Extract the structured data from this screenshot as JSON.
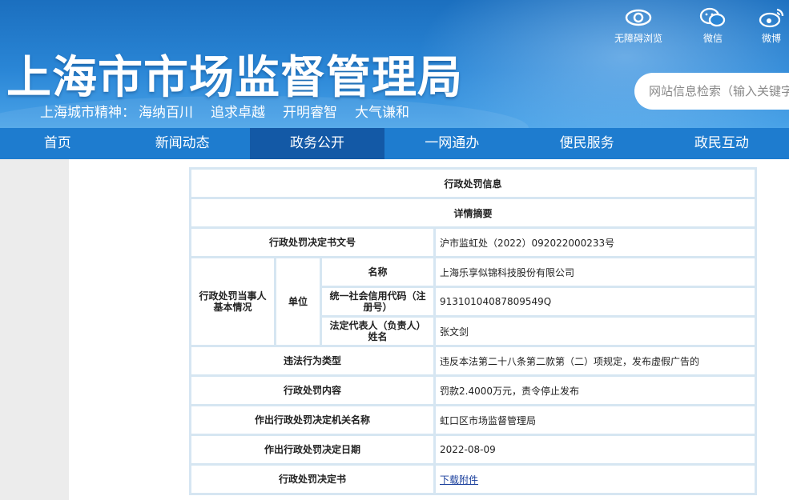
{
  "header": {
    "site_title": "上海市市场监督管理局",
    "city_spirit_lead": "上海城市精神：",
    "city_spirit": [
      "海纳百川",
      "追求卓越",
      "开明睿智",
      "大气谦和"
    ],
    "tools": {
      "accessibility": "无障碍浏览",
      "wechat": "微信",
      "weibo": "微博"
    },
    "search_placeholder": "网站信息检索（输入关键字"
  },
  "nav": [
    "首页",
    "新闻动态",
    "政务公开",
    "一网通办",
    "便民服务",
    "政民互动"
  ],
  "nav_active": "政务公开",
  "penalty": {
    "title": "行政处罚信息",
    "summary": "详情摘要",
    "doc_no_label": "行政处罚决定书文号",
    "doc_no": "沪市监虹处（2022）092022000233号",
    "party_label": "行政处罚当事人基本情况",
    "unit_label": "单位",
    "name_label": "名称",
    "name": "上海乐享似锦科技股份有限公司",
    "credit_code_label": "统一社会信用代码（注册号）",
    "credit_code": "91310104087809549Q",
    "legal_rep_label": "法定代表人（负责人）姓名",
    "legal_rep": "张文剑",
    "violation_label": "违法行为类型",
    "violation": "违反本法第二十八条第二款第（二）项规定，发布虚假广告的",
    "content_label": "行政处罚内容",
    "content": "罚款2.4000万元，责令停止发布",
    "authority_label": "作出行政处罚决定机关名称",
    "authority": "虹口区市场监督管理局",
    "date_label": "作出行政处罚决定日期",
    "date": "2022-08-09",
    "decision_label": "行政处罚决定书",
    "decision_link": "下载附件"
  }
}
